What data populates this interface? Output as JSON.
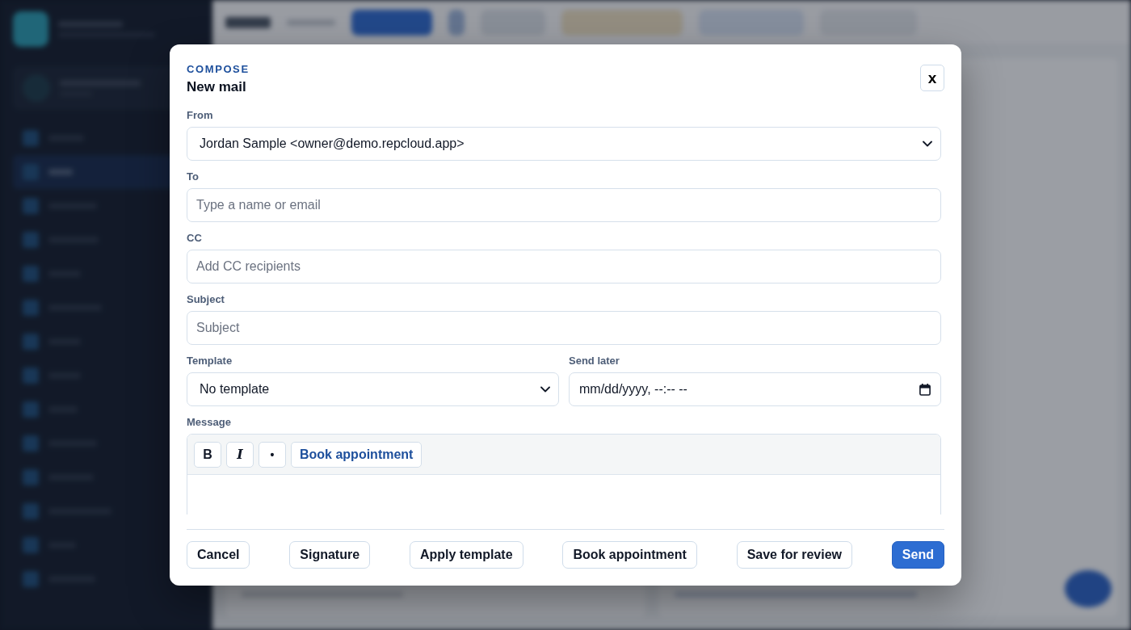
{
  "dialog": {
    "eyebrow": "COMPOSE",
    "title": "New mail",
    "close": "x"
  },
  "fields": [
    {
      "kind": "select",
      "label": "From",
      "value": "Jordan Sample <owner@demo.repcloud.app>"
    },
    {
      "kind": "input",
      "label": "To",
      "placeholder": "Type a name or email"
    },
    {
      "kind": "input",
      "label": "CC",
      "placeholder": "Add CC recipients"
    },
    {
      "kind": "input",
      "label": "Subject",
      "placeholder": "Subject"
    }
  ],
  "schedule_row": [
    {
      "kind": "select",
      "label": "Template",
      "value": "No template"
    },
    {
      "kind": "datetime",
      "label": "Send later",
      "value": "mm/dd/yyyy, --:-- --"
    }
  ],
  "message": {
    "label": "Message",
    "toolbar": [
      {
        "kind": "bold",
        "label": "B"
      },
      {
        "kind": "italic",
        "label": "I"
      },
      {
        "kind": "bullet",
        "label": "•"
      },
      {
        "kind": "action",
        "label": "Book appointment"
      }
    ]
  },
  "footer": [
    {
      "label": "Cancel",
      "primary": false
    },
    {
      "label": "Signature",
      "primary": false
    },
    {
      "label": "Apply template",
      "primary": false
    },
    {
      "label": "Book appointment",
      "primary": false
    },
    {
      "label": "Save for review",
      "primary": false
    },
    {
      "label": "Send",
      "primary": true
    }
  ]
}
